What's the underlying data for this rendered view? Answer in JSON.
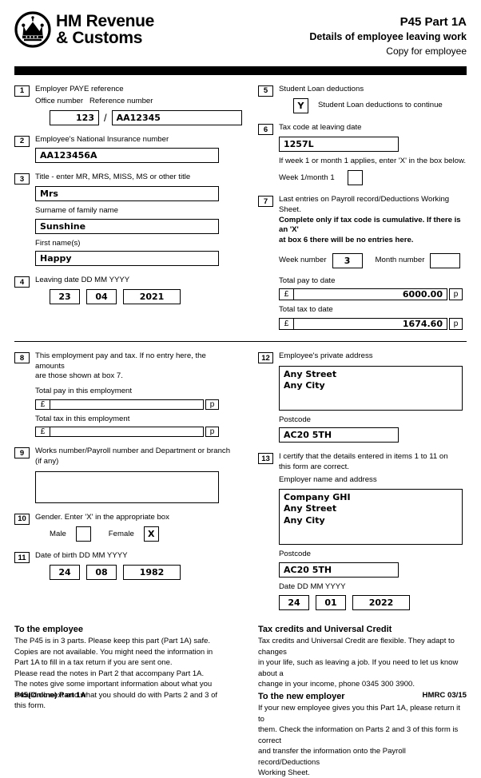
{
  "header": {
    "logo_icon": "hmrc-crown-icon",
    "brand_line1": "HM Revenue",
    "brand_line2": "& Customs",
    "title": "P45 Part 1A",
    "subtitle": "Details of employee leaving work",
    "copy_note": "Copy for employee"
  },
  "items": {
    "item1": {
      "num": "1",
      "label": "Employer PAYE reference",
      "office_label": "Office number",
      "reference_label": "Reference number",
      "office_value": "123",
      "separator": "/",
      "reference_value": "AA12345"
    },
    "item2": {
      "num": "2",
      "label": "Employee's National Insurance number",
      "value": "AA123456A"
    },
    "item3": {
      "num": "3",
      "label": "Title - enter MR, MRS, MISS, MS or other title",
      "title_value": "Mrs",
      "surname_label": "Surname of family name",
      "surname_value": "Sunshine",
      "firstname_label": "First name(s)",
      "firstname_value": "Happy"
    },
    "item4": {
      "num": "4",
      "label": "Leaving date DD MM YYYY",
      "dd": "23",
      "mm": "04",
      "yyyy": "2021"
    },
    "item5": {
      "num": "5",
      "label": "Student Loan deductions",
      "checkbox_value": "Y",
      "checkbox_label": "Student Loan deductions to continue"
    },
    "item6": {
      "num": "6",
      "label": "Tax code at leaving date",
      "value": "1257L",
      "note": "If week 1 or month 1 applies, enter 'X' in the box below.",
      "week1_label": "Week 1/month 1",
      "week1_value": ""
    },
    "item7": {
      "num": "7",
      "label_line1": "Last entries on Payroll record/Deductions Working Sheet.",
      "label_line2": "Complete only if tax code is cumulative.  If there is an 'X'",
      "label_line3": "at box 6 there will be no entries here.",
      "week_number_label": "Week number",
      "week_number_value": "3",
      "month_number_label": "Month number",
      "month_number_value": "",
      "total_pay_label": "Total pay to date",
      "total_pay_currency": "£",
      "total_pay_value": "6000.00",
      "total_pay_pence": "p",
      "total_tax_label": "Total tax to date",
      "total_tax_currency": "£",
      "total_tax_value": "1674.60",
      "total_tax_pence": "p"
    },
    "item8": {
      "num": "8",
      "label_line1": "This employment pay and tax. If no entry here, the amounts",
      "label_line2": "are those shown at box 7.",
      "total_pay_label": "Total pay in this employment",
      "total_pay_currency": "£",
      "total_pay_value": "",
      "total_pay_pence": "p",
      "total_tax_label": "Total tax in this employment",
      "total_tax_currency": "£",
      "total_tax_value": "",
      "total_tax_pence": "p"
    },
    "item9": {
      "num": "9",
      "label_line1": "Works number/Payroll number and Department or branch",
      "label_line2": "(if any)",
      "value": ""
    },
    "item10": {
      "num": "10",
      "label": "Gender. Enter 'X' in the appropriate box",
      "male_label": "Male",
      "male_value": "",
      "female_label": "Female",
      "female_value": "X"
    },
    "item11": {
      "num": "11",
      "label": "Date of birth DD MM YYYY",
      "dd": "24",
      "mm": "08",
      "yyyy": "1982"
    },
    "item12": {
      "num": "12",
      "label": "Employee's private address",
      "address_value": "Any Street\nAny City",
      "postcode_label": "Postcode",
      "postcode_value": "AC20 5TH"
    },
    "item13": {
      "num": "13",
      "label_line1": "I certify that the details entered in items 1 to 11 on",
      "label_line2": "this form are correct.",
      "employer_label": "Employer name and address",
      "employer_value": "Company GHI\nAny Street\nAny City",
      "postcode_label": "Postcode",
      "postcode_value": "AC20 5TH",
      "date_label": "Date DD MM YYYY",
      "dd": "24",
      "mm": "01",
      "yyyy": "2022"
    }
  },
  "notes": {
    "employee_heading": "To the employee",
    "employee_body": "The P45 is in 3 parts. Please keep this part (Part 1A) safe.\nCopies are not available. You might need the information in\nPart 1A to fill in a tax return if you are sent one.\nPlease read the notes in Part 2 that accompany Part 1A.\nThe notes give some important information about what you\nshould do next and what you should do with Parts 2 and 3 of\nthis form.",
    "tax_credits_heading": "Tax credits and Universal Credit",
    "tax_credits_body": "Tax credits and Universal Credit are flexible. They adapt to changes\nin your life, such as leaving a job. If you need to let us know about a\nchange in your income, phone 0345 300 3900.",
    "new_employer_heading": "To the new employer",
    "new_employer_body": "If your new employee gives you this Part 1A, please return it to\nthem. Check the information on Parts 2 and 3 of this form is correct\nand transfer the information onto the Payroll record/Deductions\nWorking Sheet."
  },
  "footer": {
    "left": "P45(Online) Part 1A",
    "right": "HMRC 03/15"
  }
}
